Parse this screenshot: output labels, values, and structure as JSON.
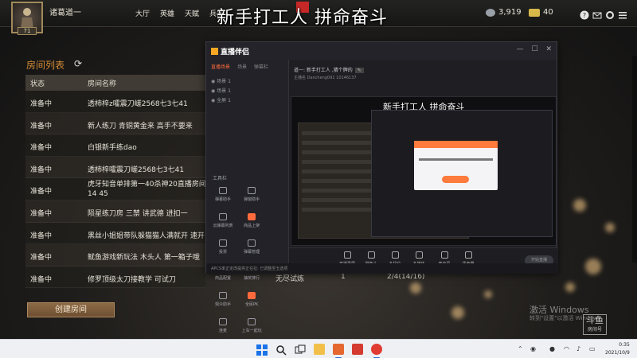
{
  "topbar": {
    "player_name": "诸葛道一",
    "level": "71",
    "nav": [
      "大厅",
      "英雄",
      "天赋",
      "兵器"
    ],
    "stream_title": "新手打工人 拼命奋斗",
    "coins": "3,919",
    "tickets": "40"
  },
  "room_list": {
    "title": "房间列表",
    "refresh_icon": "refresh-icon",
    "columns": {
      "status": "状态",
      "name": "房间名称"
    },
    "rows": [
      {
        "status": "准备中",
        "name": "透柿梓z嚯震刀嵯2568七3七41"
      },
      {
        "status": "准备中",
        "name": "新人练刀 青铜黄金来  高手不要来"
      },
      {
        "status": "准备中",
        "name": "白银新手练dao"
      },
      {
        "status": "准备中",
        "name": "透柿梓嚯震刀嵯2568七3七41"
      },
      {
        "status": "准备中",
        "name": "虎牙知音单排第一40杀神20直播房间14 45"
      },
      {
        "status": "准备中",
        "name": "陨星练刀房 三禁 讲武德 进扣一"
      },
      {
        "status": "准备中",
        "name": "黑丝小姐姐带队躲猫猫人满就开 速开"
      },
      {
        "status": "准备中",
        "name": "鱿鱼游戏新玩法 木头人 第一箱子哦"
      },
      {
        "status": "准备中",
        "name": "修罗顶级太刀接教学 可试刀"
      }
    ],
    "last_row_extra": {
      "mode": "无尽试炼",
      "count": "1",
      "players": "2/4(14/16)"
    },
    "create_button": "创建房间"
  },
  "stream_app": {
    "logo": "直播伴侣",
    "tabs": [
      "直播场景",
      "场景",
      "弹幕栏"
    ],
    "scenes": [
      "场景 1",
      "场景 1",
      "全屏 1"
    ],
    "tools_label": "工具栏",
    "tools": [
      "弹幕助手",
      "弹窗助手",
      "云弹幕列表",
      "商品上架",
      "投票",
      "弹幕管理",
      "商品配置",
      "抽奖排行",
      "观众助手",
      "全民PK",
      "连麦",
      "上车一起玩"
    ],
    "room_title": "道一: 新手打工人 ,猜个牌的",
    "room_sub": "主播名   Dancheng091   10146137",
    "overlay_title": "新手打工人 拼命奋斗",
    "bottom_tools": [
      "直播录屏",
      "摄像头",
      "多机位",
      "多媒体",
      "麦克风",
      "扬声器"
    ],
    "start_button": "开始直播",
    "status_text": "APCS率正定改提供正在拉: 已调整至五选项"
  },
  "watermark": {
    "activate": "激活 Windows",
    "activate_sub": "转到\"设置\"以激活 Windows",
    "douyu": "斗鱼",
    "douyu_sub": "房间号"
  },
  "taskbar": {
    "time": "0:35",
    "date": "2021/10/9"
  }
}
